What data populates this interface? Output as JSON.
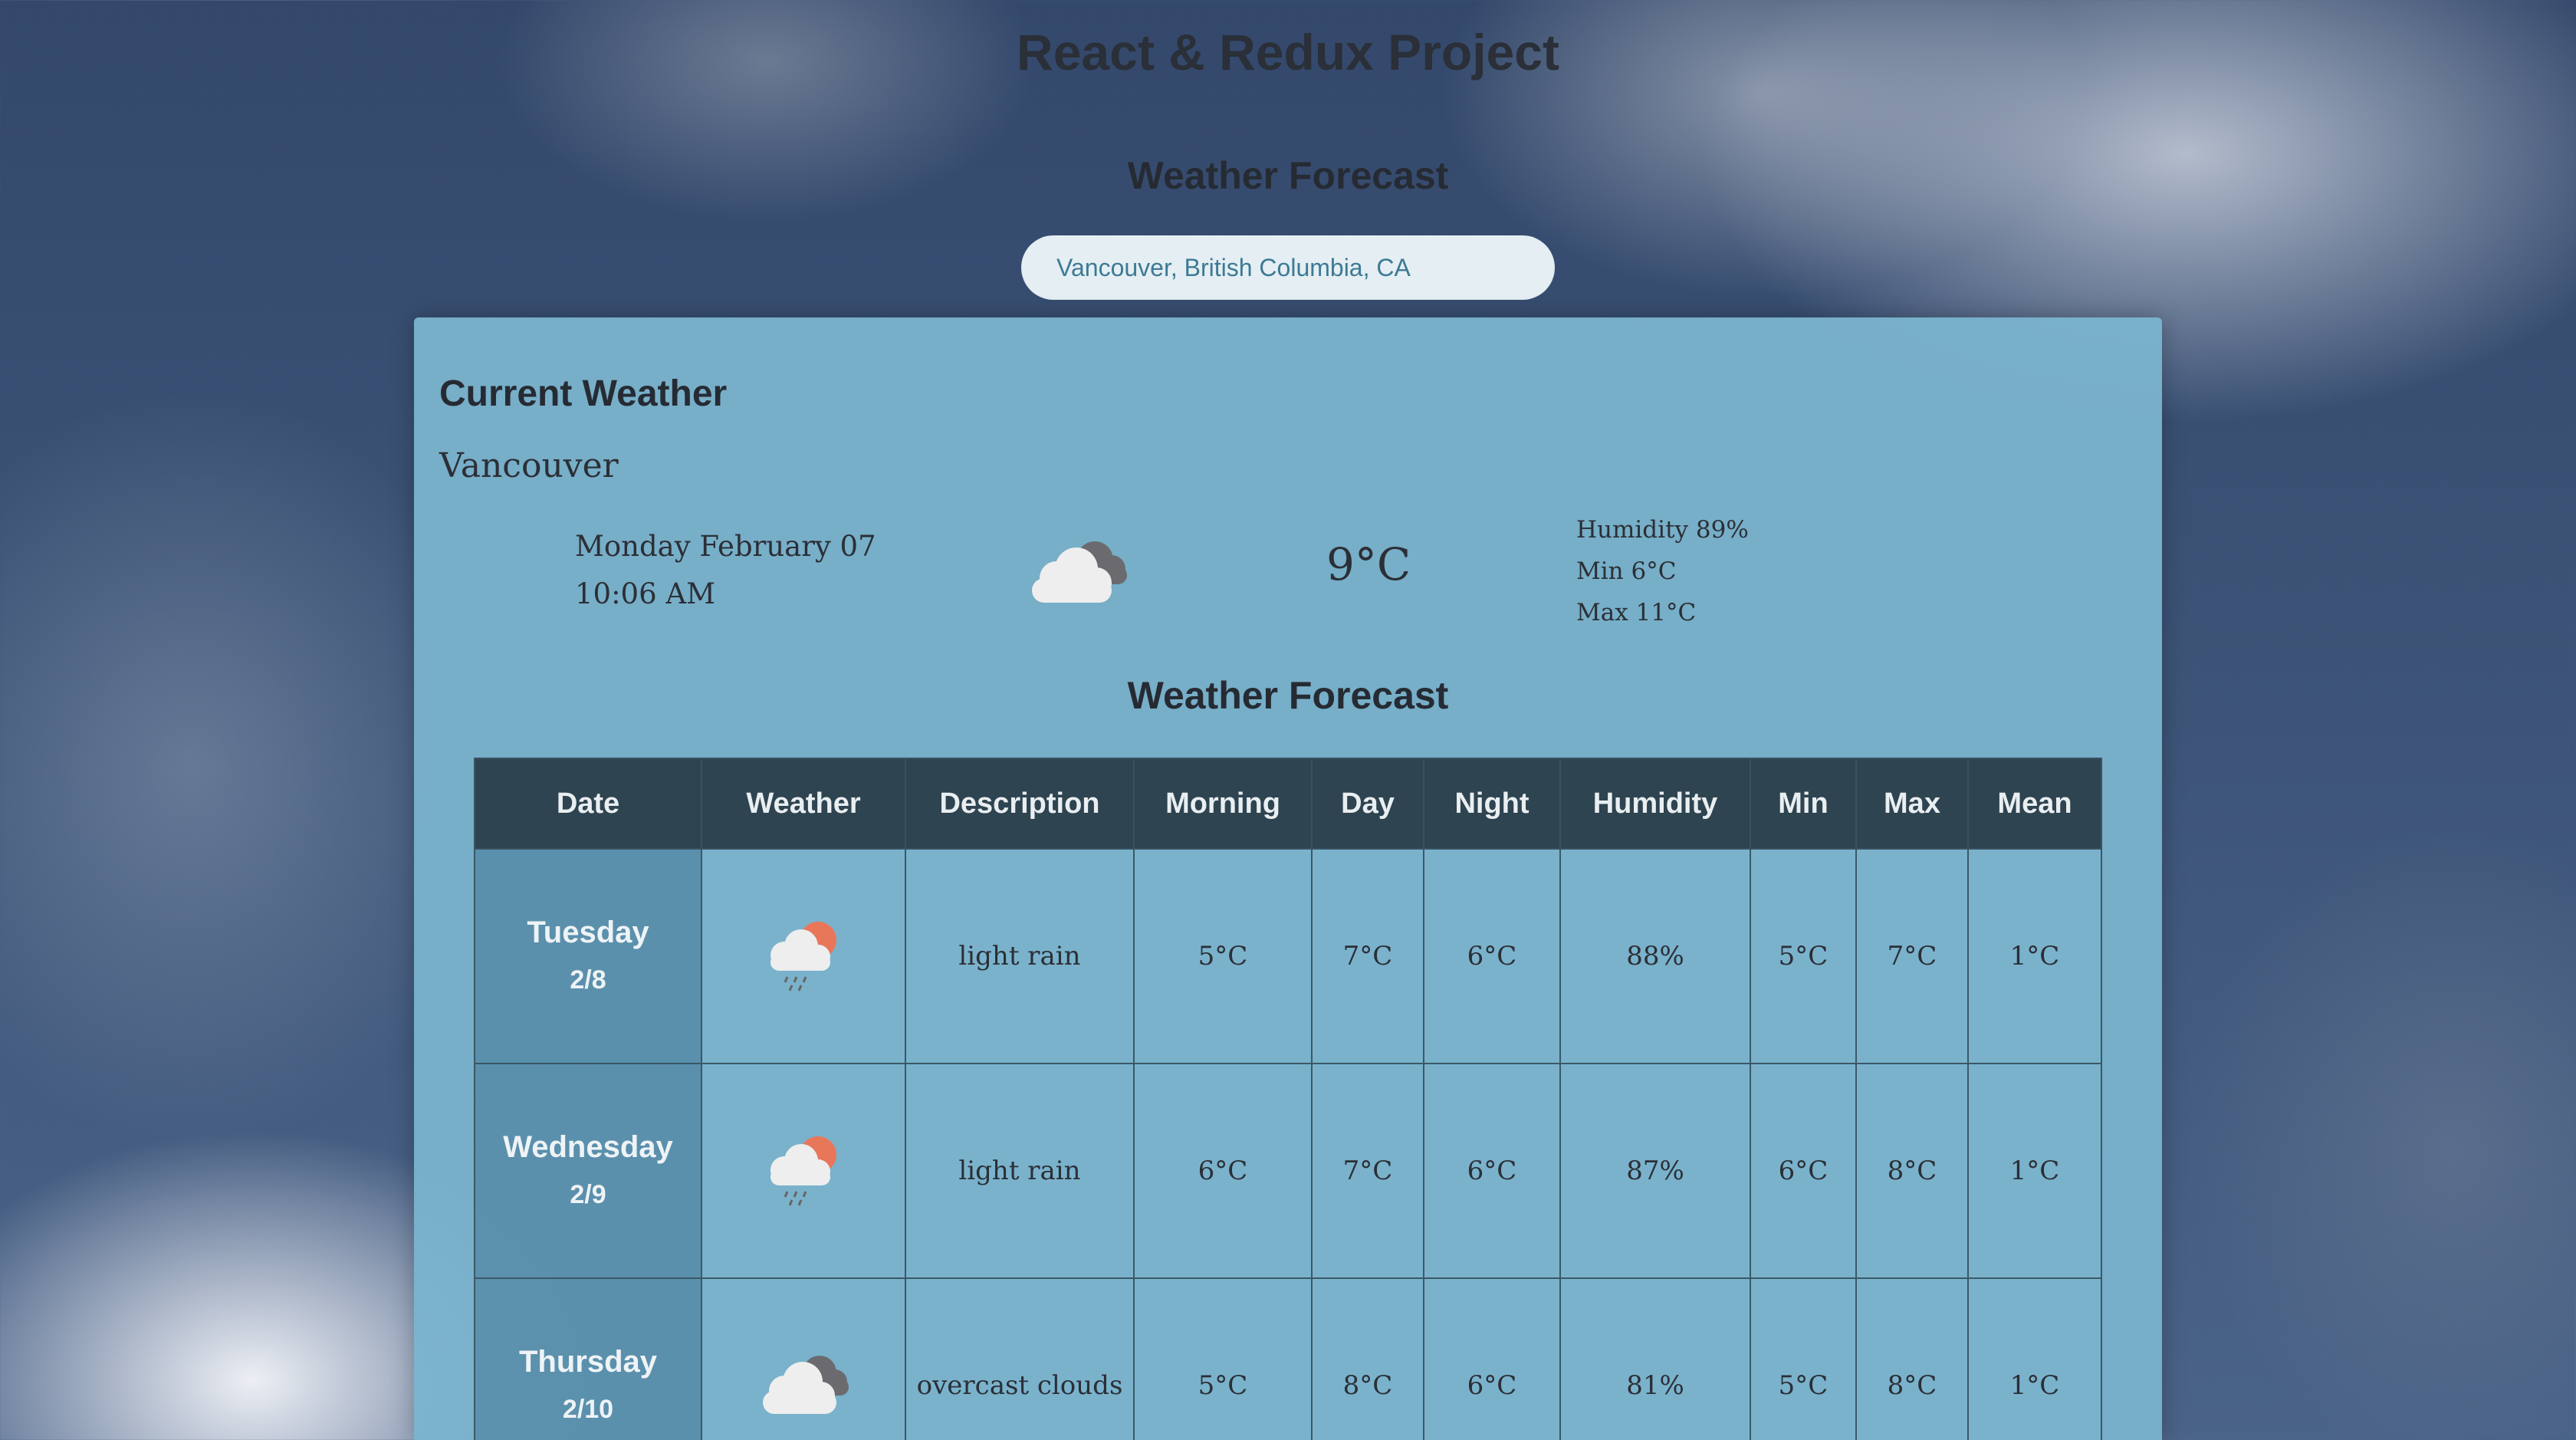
{
  "app_title": "React & Redux Project",
  "search": {
    "heading": "Weather Forecast",
    "value": "Vancouver, British Columbia, CA"
  },
  "current": {
    "title": "Current Weather",
    "city": "Vancouver",
    "date": "Monday February 07",
    "time": "10:06 AM",
    "icon": "cloudy-icon",
    "temp": "9°C",
    "humidity": "Humidity 89%",
    "min": "Min 6°C",
    "max": "Max 11°C"
  },
  "forecast": {
    "title": "Weather Forecast",
    "columns": [
      "Date",
      "Weather",
      "Description",
      "Morning",
      "Day",
      "Night",
      "Humidity",
      "Min",
      "Max",
      "Mean"
    ],
    "rows": [
      {
        "day": "Tuesday",
        "date": "2/8",
        "icon": "rain-sun-icon",
        "description": "light rain",
        "morning": "5°C",
        "day_temp": "7°C",
        "night": "6°C",
        "humidity": "88%",
        "min": "5°C",
        "max": "7°C",
        "mean": "1°C"
      },
      {
        "day": "Wednesday",
        "date": "2/9",
        "icon": "rain-sun-icon",
        "description": "light rain",
        "morning": "6°C",
        "day_temp": "7°C",
        "night": "6°C",
        "humidity": "87%",
        "min": "6°C",
        "max": "8°C",
        "mean": "1°C"
      },
      {
        "day": "Thursday",
        "date": "2/10",
        "icon": "cloudy-icon",
        "description": "overcast clouds",
        "morning": "5°C",
        "day_temp": "8°C",
        "night": "6°C",
        "humidity": "81%",
        "min": "5°C",
        "max": "8°C",
        "mean": "1°C"
      }
    ]
  },
  "colors": {
    "header_bg": "#2e4450",
    "panel_bg": "#7ab2cc",
    "search_text": "#3d7a94",
    "sun_accent": "#e8775a"
  }
}
